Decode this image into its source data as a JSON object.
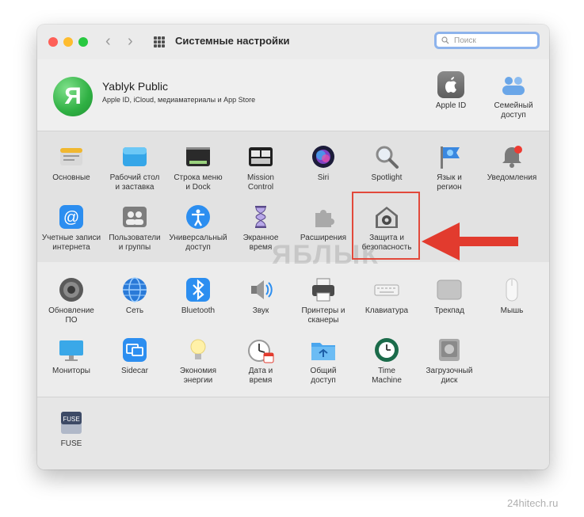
{
  "window": {
    "title": "Системные настройки"
  },
  "search": {
    "placeholder": "Поиск"
  },
  "profile": {
    "name": "Yablyk Public",
    "subtitle": "Apple ID, iCloud, медиаматериалы и App Store",
    "avatar_letter": "Я"
  },
  "top_right": [
    {
      "id": "apple-id",
      "label": "Apple ID",
      "icon": "apple-logo-icon"
    },
    {
      "id": "family",
      "label": "Семейный\nдоступ",
      "icon": "family-sharing-icon"
    }
  ],
  "section1": [
    {
      "id": "general",
      "label": "Основные",
      "icon": "general-icon"
    },
    {
      "id": "desktop",
      "label": "Рабочий стол\nи заставка",
      "icon": "desktop-icon"
    },
    {
      "id": "dock",
      "label": "Строка меню\nи Dock",
      "icon": "dock-icon"
    },
    {
      "id": "mission-control",
      "label": "Mission\nControl",
      "icon": "mission-control-icon"
    },
    {
      "id": "siri",
      "label": "Siri",
      "icon": "siri-icon"
    },
    {
      "id": "spotlight",
      "label": "Spotlight",
      "icon": "spotlight-icon"
    },
    {
      "id": "language",
      "label": "Язык и\nрегион",
      "icon": "language-region-icon"
    },
    {
      "id": "notifications",
      "label": "Уведомления",
      "icon": "notifications-icon"
    },
    {
      "id": "internet-accounts",
      "label": "Учетные записи\nинтернета",
      "icon": "internet-accounts-icon"
    },
    {
      "id": "users",
      "label": "Пользователи\nи группы",
      "icon": "users-groups-icon"
    },
    {
      "id": "accessibility",
      "label": "Универсальный\nдоступ",
      "icon": "accessibility-icon"
    },
    {
      "id": "screen-time",
      "label": "Экранное\nвремя",
      "icon": "screen-time-icon"
    },
    {
      "id": "extensions",
      "label": "Расширения",
      "icon": "extensions-icon"
    },
    {
      "id": "security",
      "label": "Защита и\nбезопасность",
      "icon": "security-house-icon"
    }
  ],
  "section2": [
    {
      "id": "software-update",
      "label": "Обновление\nПО",
      "icon": "software-update-icon"
    },
    {
      "id": "network",
      "label": "Сеть",
      "icon": "network-globe-icon"
    },
    {
      "id": "bluetooth",
      "label": "Bluetooth",
      "icon": "bluetooth-icon"
    },
    {
      "id": "sound",
      "label": "Звук",
      "icon": "speaker-icon"
    },
    {
      "id": "printers",
      "label": "Принтеры и\nсканеры",
      "icon": "printer-icon"
    },
    {
      "id": "keyboard",
      "label": "Клавиатура",
      "icon": "keyboard-icon"
    },
    {
      "id": "trackpad",
      "label": "Трекпад",
      "icon": "trackpad-icon"
    },
    {
      "id": "mouse",
      "label": "Мышь",
      "icon": "mouse-icon"
    },
    {
      "id": "displays",
      "label": "Мониторы",
      "icon": "display-icon"
    },
    {
      "id": "sidecar",
      "label": "Sidecar",
      "icon": "sidecar-icon"
    },
    {
      "id": "energy",
      "label": "Экономия\nэнергии",
      "icon": "lightbulb-icon"
    },
    {
      "id": "date-time",
      "label": "Дата и\nвремя",
      "icon": "clock-calendar-icon"
    },
    {
      "id": "sharing",
      "label": "Общий\nдоступ",
      "icon": "sharing-folder-icon"
    },
    {
      "id": "time-machine",
      "label": "Time\nMachine",
      "icon": "time-machine-icon"
    },
    {
      "id": "startup-disk",
      "label": "Загрузочный\nдиск",
      "icon": "startup-disk-icon"
    }
  ],
  "section3": [
    {
      "id": "fuse",
      "label": "FUSE",
      "icon": "fuse-drive-icon",
      "icon_text": "FUSE"
    }
  ],
  "watermark": "ЯБЛЫК",
  "site_watermark": "24hitech.ru",
  "colors": {
    "highlight": "#e2493b",
    "arrow": "#e23b2e",
    "search_focus": "#8db3ec",
    "avatar": "#2fb043"
  }
}
